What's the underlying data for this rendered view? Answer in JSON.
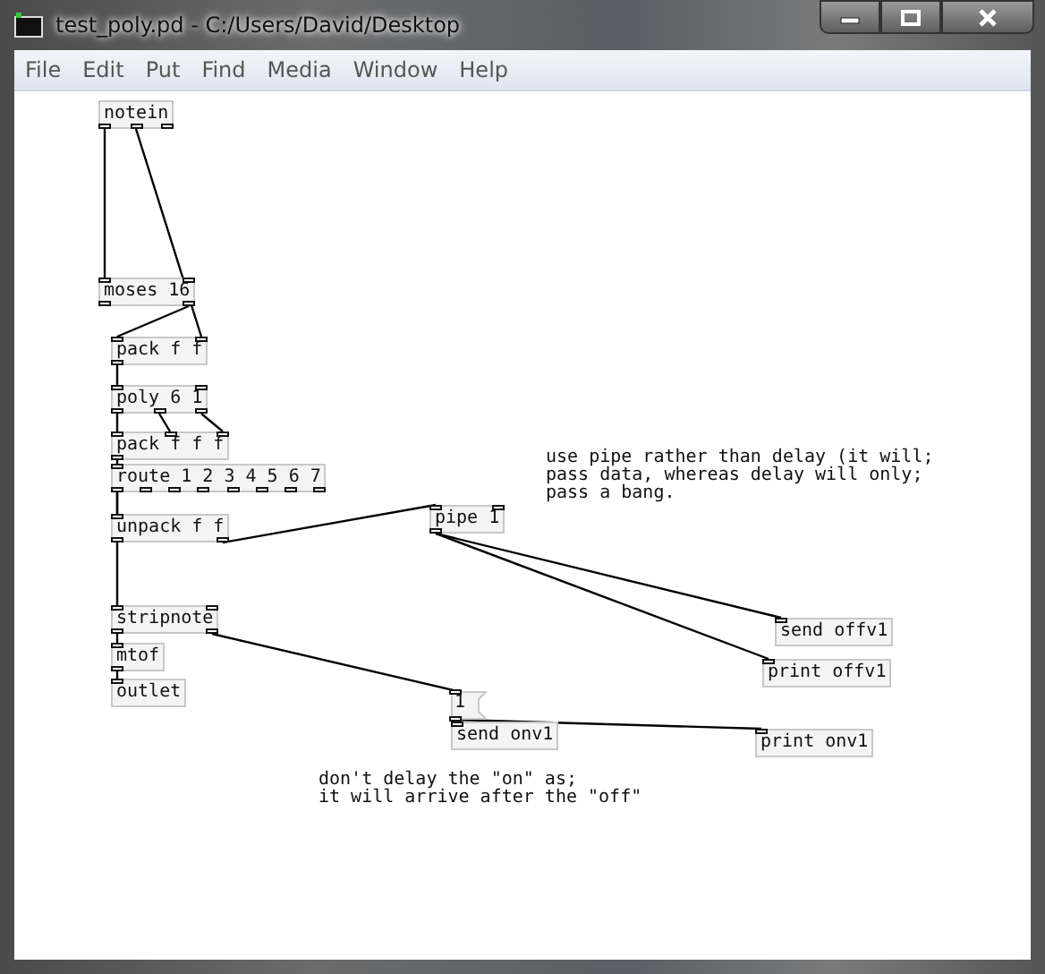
{
  "window": {
    "title": "test_poly.pd  - C:/Users/David/Desktop"
  },
  "menu": [
    "File",
    "Edit",
    "Put",
    "Find",
    "Media",
    "Window",
    "Help"
  ],
  "boxes": [
    {
      "kind": "object",
      "text": "notein"
    },
    {
      "kind": "object",
      "text": "moses 16"
    },
    {
      "kind": "object",
      "text": "pack f f"
    },
    {
      "kind": "object",
      "text": "poly 6 1"
    },
    {
      "kind": "object",
      "text": "pack f f f"
    },
    {
      "kind": "object",
      "text": "route 1 2 3 4 5 6 7"
    },
    {
      "kind": "comment",
      "text": "use pipe rather than delay (it will;\npass data, whereas delay will only;\npass a bang."
    },
    {
      "kind": "object",
      "text": "unpack f f"
    },
    {
      "kind": "object",
      "text": "pipe 1"
    },
    {
      "kind": "object",
      "text": "stripnote"
    },
    {
      "kind": "object",
      "text": "send offv1"
    },
    {
      "kind": "object",
      "text": "mtof"
    },
    {
      "kind": "object",
      "text": "print offv1"
    },
    {
      "kind": "object",
      "text": "outlet"
    },
    {
      "kind": "message",
      "text": "1"
    },
    {
      "kind": "object",
      "text": "send onv1"
    },
    {
      "kind": "object",
      "text": "print onv1"
    },
    {
      "kind": "comment",
      "text": "don't delay the \"on\" as;\nit will arrive after the \"off\""
    }
  ]
}
